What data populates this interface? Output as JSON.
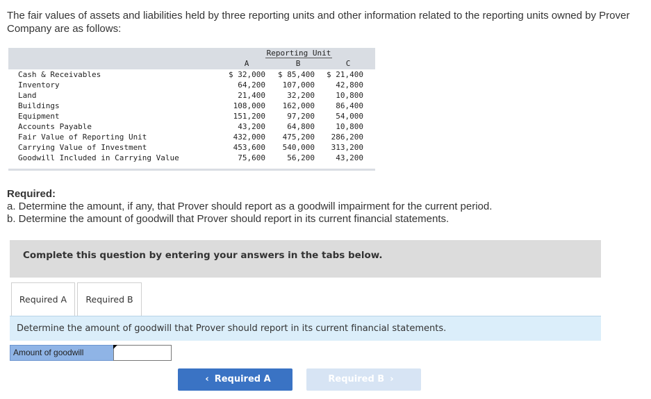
{
  "intro": "The fair values of assets and liabilities held by three reporting units and other information related to the reporting units owned by Prover Company are as follows:",
  "table": {
    "group_header": "Reporting Unit",
    "columns": [
      "A",
      "B",
      "C"
    ],
    "rows": [
      {
        "label": "Cash & Receivables",
        "a": "$ 32,000",
        "b": "$ 85,400",
        "c": "$ 21,400"
      },
      {
        "label": "Inventory",
        "a": "64,200",
        "b": "107,000",
        "c": "42,800"
      },
      {
        "label": "Land",
        "a": "21,400",
        "b": "32,200",
        "c": "10,800"
      },
      {
        "label": "Buildings",
        "a": "108,000",
        "b": "162,000",
        "c": "86,400"
      },
      {
        "label": "Equipment",
        "a": "151,200",
        "b": "97,200",
        "c": "54,000"
      },
      {
        "label": "Accounts Payable",
        "a": "43,200",
        "b": "64,800",
        "c": "10,800"
      },
      {
        "label": "Fair Value of Reporting Unit",
        "a": "432,000",
        "b": "475,200",
        "c": "286,200"
      },
      {
        "label": "Carrying Value of Investment",
        "a": "453,600",
        "b": "540,000",
        "c": "313,200"
      },
      {
        "label": "Goodwill Included in Carrying Value",
        "a": "75,600",
        "b": "56,200",
        "c": "43,200"
      }
    ]
  },
  "required": {
    "title": "Required:",
    "a": "a. Determine the amount, if any, that Prover should report as a goodwill impairment for the current period.",
    "b": "b. Determine the amount of goodwill that Prover should report in its current financial statements."
  },
  "banner": "Complete this question by entering your answers in the tabs below.",
  "tabs": [
    "Required A",
    "Required B"
  ],
  "prompt": "Determine the amount of goodwill that Prover should report in its current financial statements.",
  "answer": {
    "label": "Amount of goodwill",
    "value": ""
  },
  "nav": {
    "prev": "Required A",
    "next": "Required B"
  }
}
